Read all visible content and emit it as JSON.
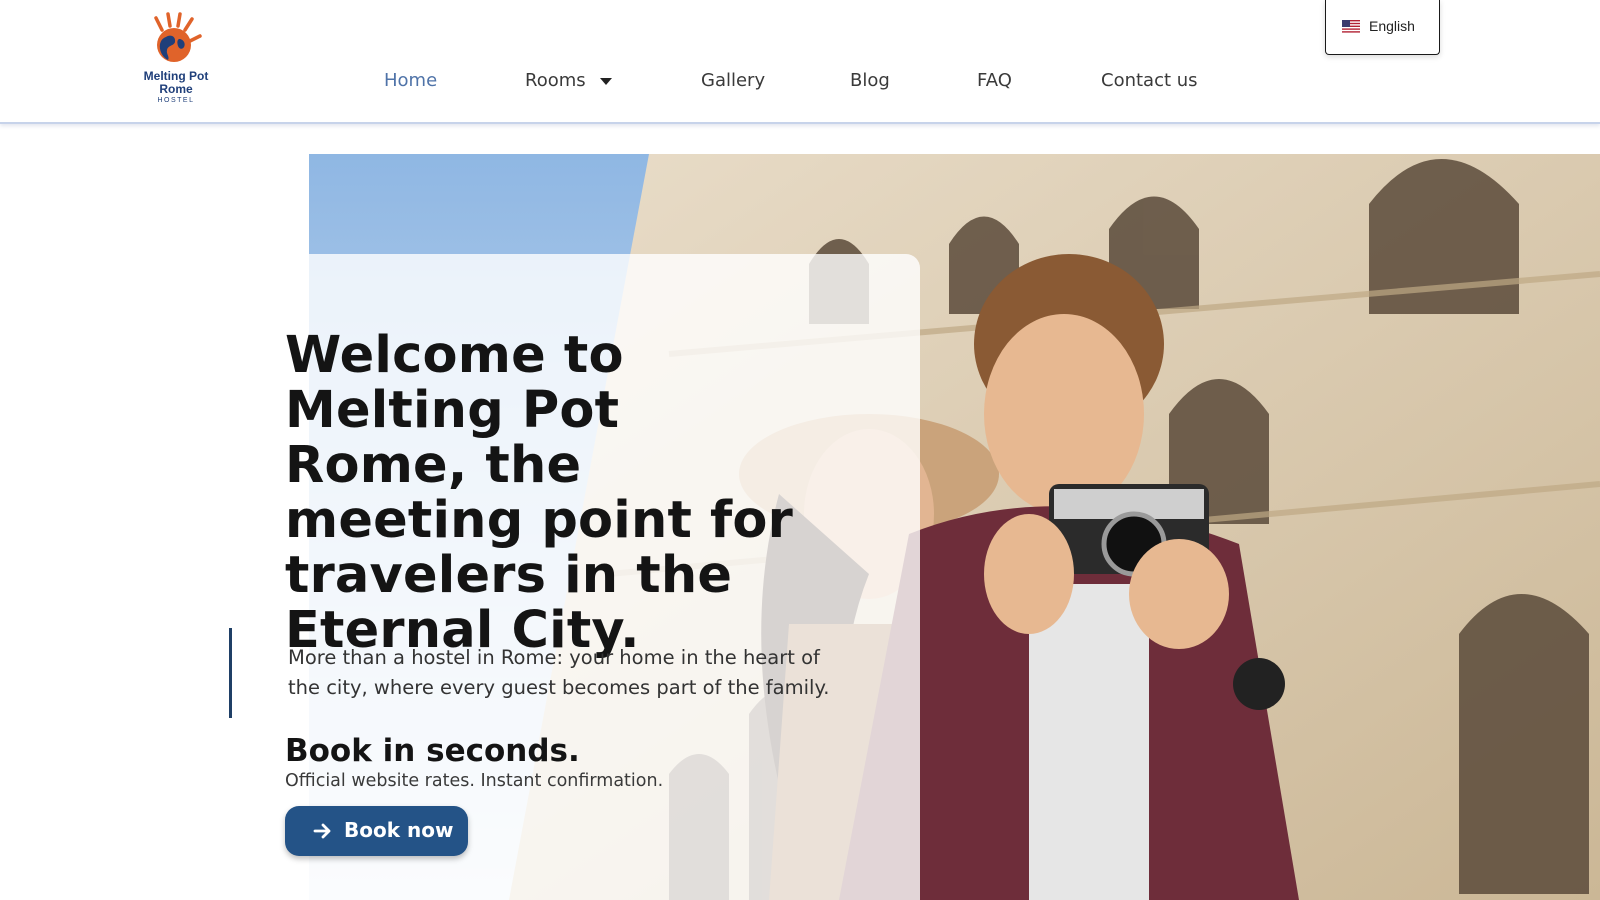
{
  "header": {
    "logo": {
      "line1": "Melting Pot",
      "line2": "Rome",
      "line3": "HOSTEL",
      "icon": "hand-globe-logo"
    },
    "nav": [
      {
        "label": "Home",
        "active": true
      },
      {
        "label": "Rooms",
        "has_dropdown": true
      },
      {
        "label": "Gallery"
      },
      {
        "label": "Blog"
      },
      {
        "label": "FAQ"
      },
      {
        "label": "Contact us"
      }
    ],
    "language": {
      "label": "English",
      "icon": "us-flag-icon"
    }
  },
  "hero": {
    "headline": "Welcome to Melting Pot Rome, the meeting point for travelers in the Eternal City.",
    "subtext": "More than a hostel in Rome: your home in the heart of the city, where every guest becomes part of the family.",
    "book_title": "Book in seconds.",
    "book_subtitle": "Official website rates. Instant confirmation.",
    "book_button": "Book now",
    "book_button_icon": "arrow-right-icon"
  },
  "colors": {
    "accent": "#245387",
    "nav_active": "#4f73a8",
    "logo_orange": "#e0632a",
    "logo_blue": "#1f3f7a"
  }
}
